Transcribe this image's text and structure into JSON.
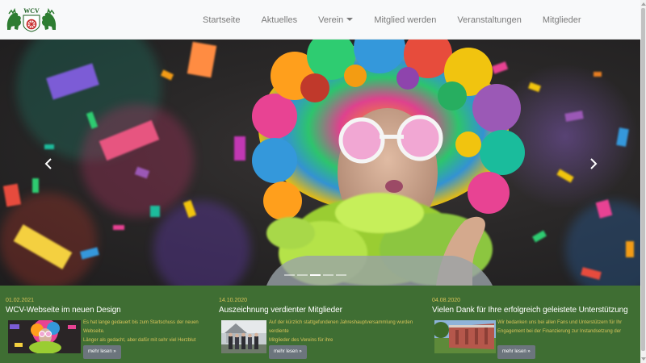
{
  "logo": {
    "text": "WCV"
  },
  "nav": {
    "items": [
      {
        "label": "Startseite"
      },
      {
        "label": "Aktuelles"
      },
      {
        "label": "Verein"
      },
      {
        "label": "Mitglied werden"
      },
      {
        "label": "Veranstaltungen"
      },
      {
        "label": "Mitglieder"
      }
    ]
  },
  "carousel": {
    "slide_count": 5,
    "active_index": 2,
    "prev_icon": "chevron-left-icon",
    "next_icon": "chevron-right-icon"
  },
  "news": [
    {
      "date": "01.02.2021",
      "title": "WCV-Webseite im neuen Design",
      "text_line1": "Es hat lange gedauert bis zum Startschuss der neuen Webseite.",
      "text_line2": "Länger als gedacht, aber dafür mit sehr viel Herzblut",
      "button": "mehr lesen »"
    },
    {
      "date": "14.10.2020",
      "title": "Auszeichnung verdienter Mitglieder",
      "text_line1": "Auf der kürzlich stattgefundenen Jahreshauptversammlung wurden verdiente",
      "text_line2": "Mitglieder des Vereins für ihre",
      "button": "mehr lesen »"
    },
    {
      "date": "04.08.2020",
      "title": "Vielen Dank für Ihre erfolgreich geleistete Unterstützung",
      "text_line1": "Wir bedanken uns bei allen Fans und Unterstützern für Ihr",
      "text_line2": "Engagement bei der Finanzierung zur Instandsetzung der",
      "button": "mehr lesen »"
    }
  ],
  "colors": {
    "news_background": "#3f6e33",
    "news_date": "#d8c45a",
    "button": "#6c757d",
    "navbar": "#f8f9fa"
  }
}
